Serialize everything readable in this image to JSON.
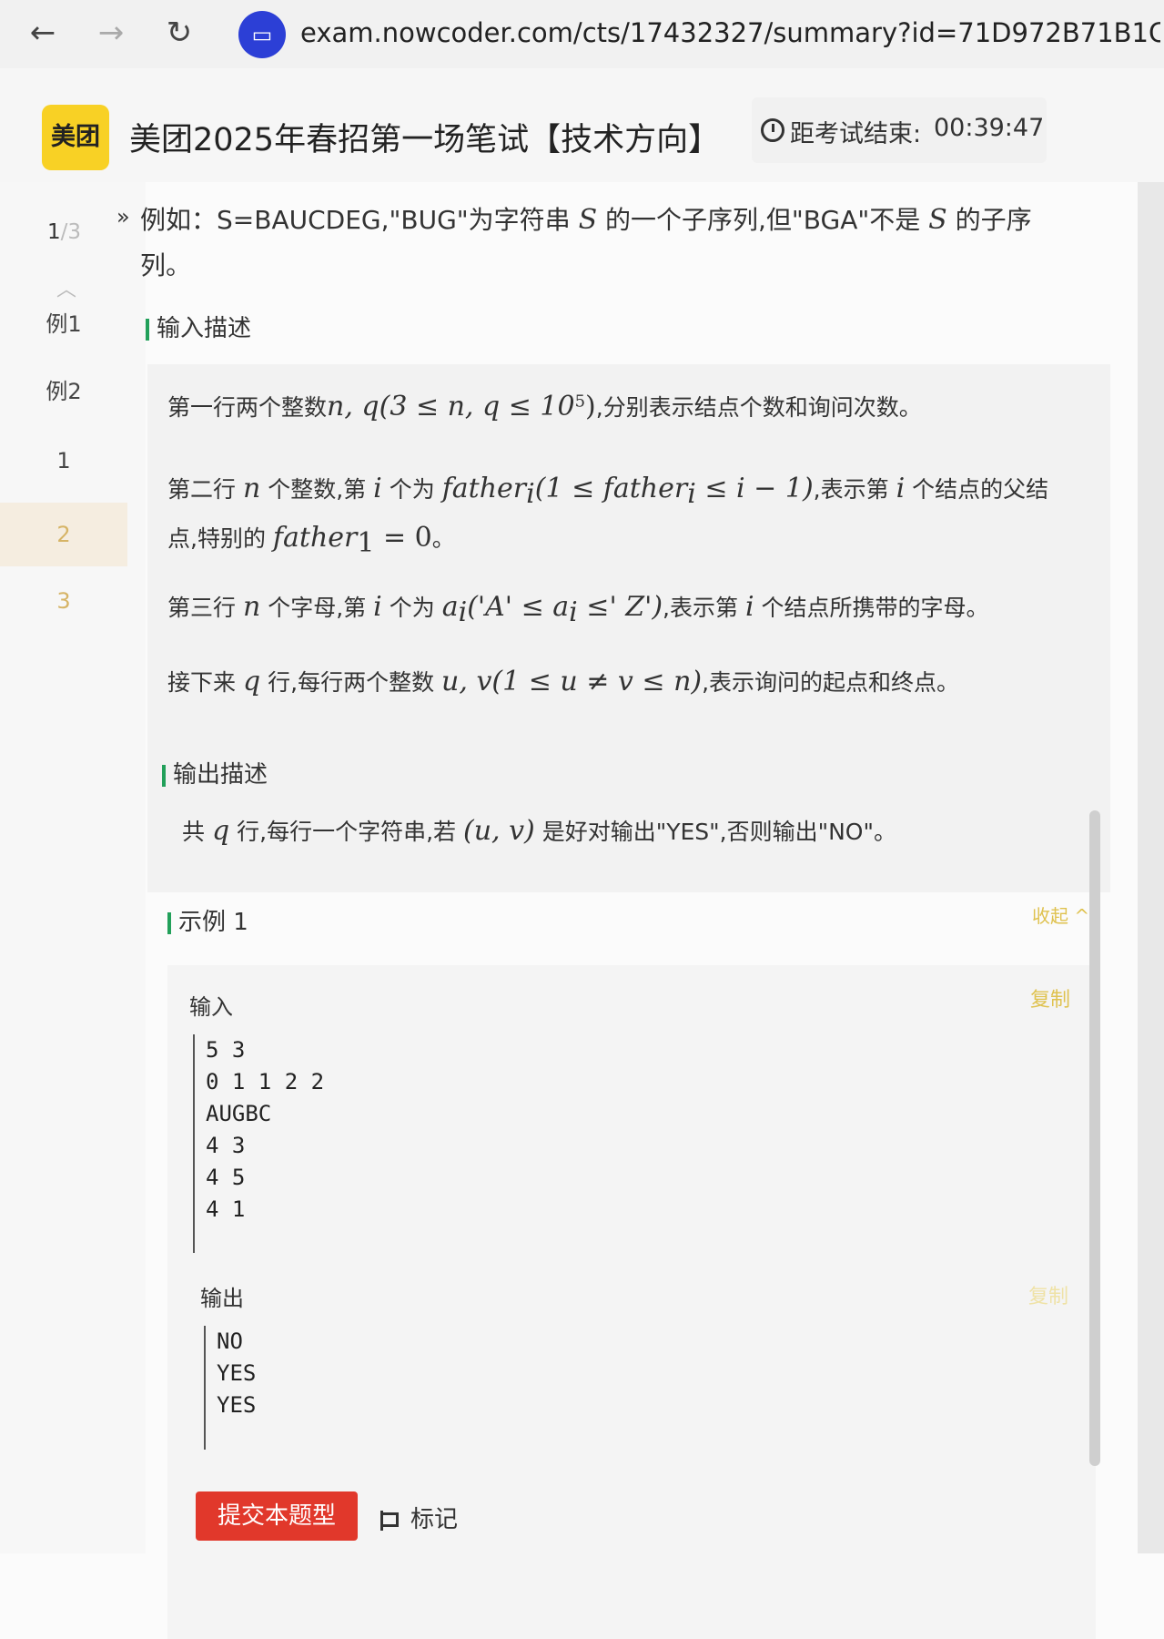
{
  "browser": {
    "back": "←",
    "forward": "→",
    "reload": "↻",
    "url": "exam.nowcoder.com/cts/17432327/summary?id=71D972B71B1CF3"
  },
  "header": {
    "logo_text": "美团",
    "title": "美团2025年春招第一场笔试【技术方向】",
    "timer_label": "距考试结束:",
    "timer_value": "00:39:47"
  },
  "nav": {
    "progress_current": "1",
    "progress_sep": "/3",
    "items": [
      "例1",
      "例2",
      "1",
      "2",
      "3"
    ]
  },
  "question": {
    "intro_prefix": "例如：S=BAUCDEG,\"BUG\"为字符串",
    "intro_mid": "的一个子序列,但\"BGA\"不是",
    "intro_suffix": "的子序",
    "intro_line2": "列。",
    "sym_S": "S"
  },
  "input_desc": {
    "heading": "输入描述",
    "line1_pre": "第一行两个整数",
    "line1_math": "n, q(3 ≤ n, q ≤ 10",
    "line1_sup": "5",
    "line1_close": ")",
    "line1_post": ",分别表示结点个数和询问次数。",
    "line2_pre": "第二行",
    "line2_n": "n",
    "line2_a": "个整数,第",
    "line2_i": "i",
    "line2_b": "个为",
    "line2_math1": "father",
    "line2_sub1": "i",
    "line2_math2": "(1 ≤ father",
    "line2_sub2": "i",
    "line2_math3": " ≤ i − 1)",
    "line2_c": ",表示第",
    "line2_d": "个结点的父结",
    "line3_pre": "点,特别的",
    "line3_math": "father",
    "line3_sub": "1",
    "line3_eq": " = 0",
    "line3_post": "。",
    "line4_pre": "第三行",
    "line4_a": "个字母,第",
    "line4_b": "个为",
    "line4_math": "a",
    "line4_sub": "i",
    "line4_math2": "('A' ≤ a",
    "line4_sub2": "i",
    "line4_math3": " ≤' Z')",
    "line4_c": ",表示第",
    "line4_d": "个结点所携带的字母。",
    "line5_pre": "接下来",
    "line5_q": "q",
    "line5_a": "行,每行两个整数",
    "line5_math": "u, v(1 ≤ u ≠ v ≤ n)",
    "line5_b": ",表示询问的起点和终点。"
  },
  "output_desc": {
    "heading": "输出描述",
    "pre": "共",
    "q": "q",
    "a": "行,每行一个字符串,若",
    "math": "(u, v)",
    "b": "是好对输出\"YES\",否则输出\"NO\"。"
  },
  "example": {
    "heading": "示例 1",
    "collapse": "收起 ^",
    "input_label": "输入",
    "output_label": "输出",
    "copy": "复制",
    "input_lines": [
      "5 3",
      "0 1 1 2 2",
      "AUGBC",
      "4 3",
      "4 5",
      "4 1"
    ],
    "output_lines": [
      "NO",
      "YES",
      "YES"
    ]
  },
  "footer": {
    "submit": "提交本题型",
    "mark": "标记"
  }
}
